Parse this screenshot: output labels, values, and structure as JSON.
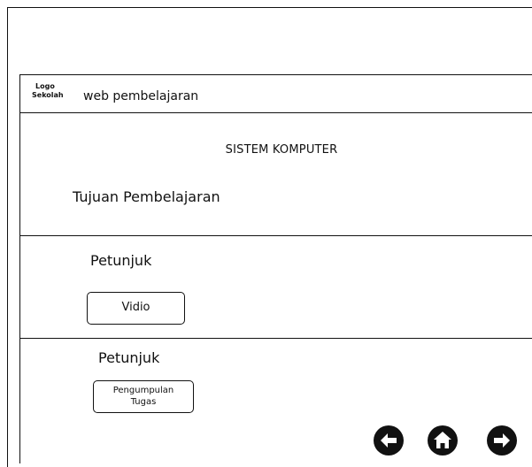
{
  "header": {
    "logo_line1": "Logo",
    "logo_line2": "Sekolah",
    "site_title": "web pembelajaran"
  },
  "main": {
    "subject_title": "SISTEM KOMPUTER",
    "objective_label": "Tujuan Pembelajaran"
  },
  "sections": [
    {
      "label": "Petunjuk",
      "button_label": "Vidio"
    },
    {
      "label": "Petunjuk",
      "button_label_line1": "Pengumpulan",
      "button_label_line2": "Tugas"
    }
  ],
  "nav": {
    "icons": [
      "arrow-left-icon",
      "home-icon",
      "arrow-right-icon"
    ],
    "icon_color": "#111111"
  }
}
